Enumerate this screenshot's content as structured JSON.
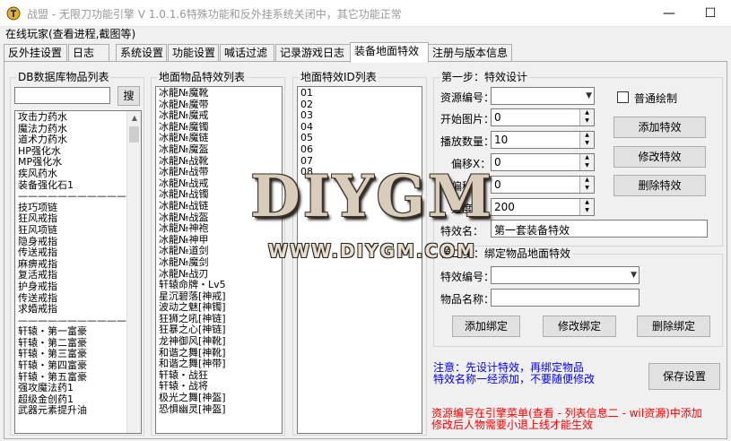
{
  "window": {
    "title": "战盟 - 无限刀功能引擎 V 1.0.1.6特殊功能和反外挂系统关闭中，其它功能正常",
    "icon": "game-logo-icon",
    "minimize": "—",
    "maximize": "☐"
  },
  "status": "在线玩家(查看进程,截图等)",
  "tabs": [
    {
      "label": "反外挂设置"
    },
    {
      "label": "日志"
    },
    {
      "label": "系统设置"
    },
    {
      "label": "功能设置"
    },
    {
      "label": "喊话过滤"
    },
    {
      "label": "记录游戏日志"
    },
    {
      "label": "装备地面特效"
    },
    {
      "label": "注册与版本信息"
    }
  ],
  "db_items": {
    "title": "DB数据库物品列表",
    "search_value": "",
    "search_button": "搜",
    "items": [
      "攻击力药水",
      "魔法力药水",
      "道术力药水",
      "HP强化水",
      "MP强化水",
      "疾风药水",
      "装备强化石1",
      "———————————",
      "技巧项链",
      "狂风戒指",
      "狂风项链",
      "隐身戒指",
      "传送戒指",
      "麻痹戒指",
      "复活戒指",
      "护身戒指",
      "传送戒指",
      "求婚戒指",
      "———————————",
      "轩辕・第一富豪",
      "轩辕・第二富豪",
      "轩辕・第三富豪",
      "轩辕・第四富豪",
      "轩辕・第五富豪",
      "强攻魔法药1",
      "超级金创药1",
      "武器元素提升油"
    ]
  },
  "ground_items": {
    "title": "地面物品特效列表",
    "items": [
      "冰龍№魔靴",
      "冰龍№魔带",
      "冰龍№魔戒",
      "冰龍№魔镯",
      "冰龍№魔链",
      "冰龍№魔盔",
      "冰龍№战靴",
      "冰龍№战带",
      "冰龍№战戒",
      "冰龍№战镯",
      "冰龍№战链",
      "冰龍№战盔",
      "冰龍№神袍",
      "冰龍№神甲",
      "冰龍№道剑",
      "冰龍№魔剑",
      "冰龍№战刃",
      "轩辕命牌・Lv5",
      "星沉碧落[神戒]",
      "波动之魅[神镯]",
      "狂狮之吼[神链]",
      "狂暴之心[神链]",
      "龙神御风[神靴]",
      "和谐之舞[神靴]",
      "和谐之舞[神带]",
      "轩辕・战狂",
      "轩辕・战将",
      "极光之舞[神盔]",
      "恐惧幽灵[神盔]"
    ]
  },
  "effect_ids": {
    "title": "地面特效ID列表",
    "items": [
      "01",
      "02",
      "03",
      "04",
      "05",
      "06",
      "07",
      "08"
    ]
  },
  "step1": {
    "title": "第一步：特效设计",
    "resource_label": "资源编号：",
    "resource_value": "",
    "start_label": "开始图片：",
    "start_value": "0",
    "play_label": "播放数量：",
    "play_value": "10",
    "offx_label": "偏移X：",
    "offx_value": "0",
    "offy_label": "偏移Y：",
    "offy_value": "0",
    "speed_label": "速度：",
    "speed_value": "200",
    "name_label": "特效名：",
    "name_value": "第一套装备特效",
    "normal_draw_label": "普通绘制",
    "normal_draw_checked": false,
    "add_button": "添加特效",
    "modify_button": "修改特效",
    "delete_button": "删除特效"
  },
  "step2": {
    "title": "第二步：绑定物品地面特效",
    "effect_no_label": "特效编号：",
    "effect_no_value": "",
    "item_name_label": "物品名称：",
    "item_name_value": "",
    "add_button": "添加绑定",
    "modify_button": "修改绑定",
    "delete_button": "删除绑定"
  },
  "notes": {
    "blue_line1": "注意：先设计特效，再绑定物品",
    "blue_line2": "特效名称一经添加，不要随便修改",
    "red_line1": "资源编号在引擎菜单(查看 - 列表信息二 - wil资源)中添加",
    "red_line2": "修改后人物需要小退上线才能生效"
  },
  "save_button": "保存设置",
  "watermark": {
    "logo": "DIYGM",
    "url": "WWW.DIYGM.COM"
  }
}
